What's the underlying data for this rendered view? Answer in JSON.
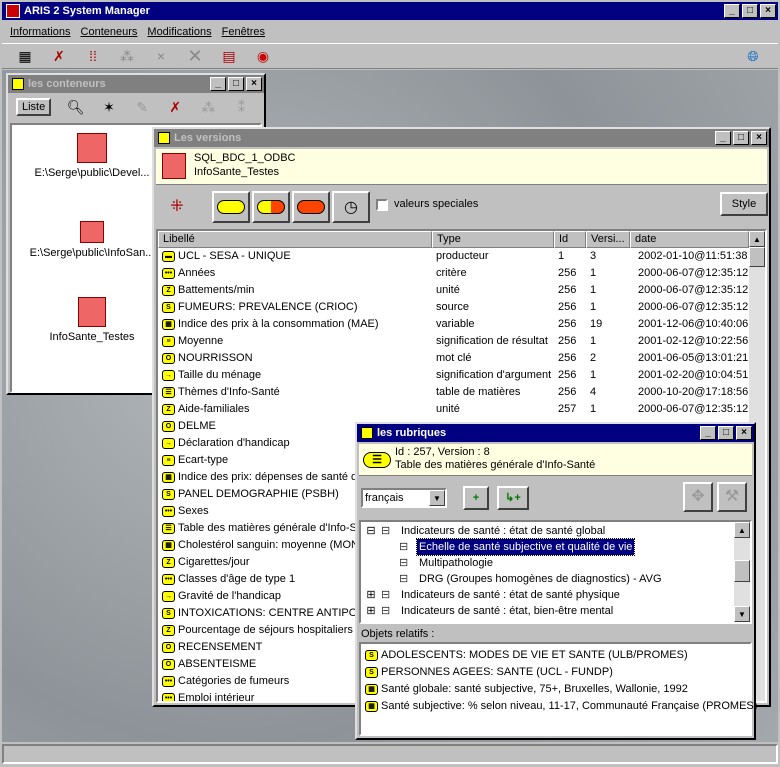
{
  "app": {
    "title": "ARIS 2 System Manager"
  },
  "menu": [
    "Informations",
    "Conteneurs",
    "Modifications",
    "Fenêtres"
  ],
  "conteneurs": {
    "title": "les conteneurs",
    "liste_label": "Liste",
    "items": [
      "E:\\Serge\\public\\Devel...",
      "E:\\Serge\\public\\InfoSan...",
      "InfoSante_Testes"
    ]
  },
  "versions": {
    "title": "Les versions",
    "db_line1": "SQL_BDC_1_ODBC",
    "db_line2": "InfoSante_Testes",
    "valeurs_label": "valeurs speciales",
    "style_label": "Style",
    "columns": [
      "Libellé",
      "Type",
      "Id",
      "Versi...",
      "date"
    ],
    "rows": [
      {
        "icon": "bar",
        "label": "UCL - SESA - UNIQUE",
        "type": "producteur",
        "id": "1",
        "ver": "3",
        "date": "2002-01-10@11:51:38"
      },
      {
        "icon": "dots",
        "label": "Années",
        "type": "critère",
        "id": "256",
        "ver": "1",
        "date": "2000-06-07@12:35:12"
      },
      {
        "icon": "z",
        "label": "Battements/min",
        "type": "unité",
        "id": "256",
        "ver": "1",
        "date": "2000-06-07@12:35:12"
      },
      {
        "icon": "src",
        "label": "FUMEURS: PREVALENCE (CRIOC)",
        "type": "source",
        "id": "256",
        "ver": "1",
        "date": "2000-06-07@12:35:12"
      },
      {
        "icon": "grid",
        "label": "Indice des prix à la consommation (MAE)",
        "type": "variable",
        "id": "256",
        "ver": "19",
        "date": "2001-12-06@10:40:06"
      },
      {
        "icon": "sig",
        "label": "Moyenne",
        "type": "signification de résultat",
        "id": "256",
        "ver": "1",
        "date": "2001-02-12@10:22:56"
      },
      {
        "icon": "key",
        "label": "NOURRISSON",
        "type": "mot clé",
        "id": "256",
        "ver": "2",
        "date": "2001-06-05@13:01:21"
      },
      {
        "icon": "arg",
        "label": "Taille du ménage",
        "type": "signification d'argument",
        "id": "256",
        "ver": "1",
        "date": "2001-02-20@10:04:51"
      },
      {
        "icon": "toc",
        "label": "Thèmes d'Info-Santé",
        "type": "table de matières",
        "id": "256",
        "ver": "4",
        "date": "2000-10-20@17:18:56"
      },
      {
        "icon": "z",
        "label": "Aide-familiales",
        "type": "unité",
        "id": "257",
        "ver": "1",
        "date": "2000-06-07@12:35:12"
      },
      {
        "icon": "key",
        "label": "DELME",
        "type": "",
        "id": "",
        "ver": "",
        "date": ""
      },
      {
        "icon": "arg",
        "label": "Déclaration d'handicap",
        "type": "",
        "id": "",
        "ver": "",
        "date": ""
      },
      {
        "icon": "sig",
        "label": "Ecart-type",
        "type": "",
        "id": "",
        "ver": "",
        "date": ""
      },
      {
        "icon": "grid",
        "label": "Indice des prix: dépenses de santé de",
        "type": "",
        "id": "",
        "ver": "",
        "date": ""
      },
      {
        "icon": "src",
        "label": "PANEL DEMOGRAPHIE (PSBH)",
        "type": "",
        "id": "",
        "ver": "",
        "date": ""
      },
      {
        "icon": "dots",
        "label": "Sexes",
        "type": "",
        "id": "",
        "ver": "",
        "date": ""
      },
      {
        "icon": "toc",
        "label": "Table des matières générale d'Info-Sa",
        "type": "",
        "id": "",
        "ver": "",
        "date": ""
      },
      {
        "icon": "grid",
        "label": "Cholestérol sanguin: moyenne (MONI",
        "type": "",
        "id": "",
        "ver": "",
        "date": ""
      },
      {
        "icon": "z",
        "label": "Cigarettes/jour",
        "type": "",
        "id": "",
        "ver": "",
        "date": ""
      },
      {
        "icon": "dots",
        "label": "Classes d'âge de type 1",
        "type": "",
        "id": "",
        "ver": "",
        "date": ""
      },
      {
        "icon": "arg",
        "label": "Gravité de l'handicap",
        "type": "",
        "id": "",
        "ver": "",
        "date": ""
      },
      {
        "icon": "src",
        "label": "INTOXICATIONS: CENTRE ANTIPO",
        "type": "",
        "id": "",
        "ver": "",
        "date": ""
      },
      {
        "icon": "z",
        "label": "Pourcentage de séjours hospitaliers",
        "type": "",
        "id": "",
        "ver": "",
        "date": ""
      },
      {
        "icon": "key",
        "label": "RECENSEMENT",
        "type": "",
        "id": "",
        "ver": "",
        "date": ""
      },
      {
        "icon": "key",
        "label": "ABSENTEISME",
        "type": "",
        "id": "",
        "ver": "",
        "date": ""
      },
      {
        "icon": "dots",
        "label": "Catégories de fumeurs",
        "type": "",
        "id": "",
        "ver": "",
        "date": ""
      },
      {
        "icon": "dots",
        "label": "Emploi intérieur",
        "type": "",
        "id": "",
        "ver": "",
        "date": ""
      }
    ]
  },
  "rubriques": {
    "title": "les rubriques",
    "info_line1": "Id : 257, Version : 8",
    "info_line2": "Table des matières générale d'Info-Santé",
    "language": "français",
    "tree": [
      {
        "indent": 0,
        "exp": "⊟",
        "label": "Indicateurs de santé : état de santé global",
        "sel": false
      },
      {
        "indent": 1,
        "exp": "",
        "label": "Echelle de santé subjective et qualité de vie",
        "sel": true
      },
      {
        "indent": 1,
        "exp": "",
        "label": "Multipathologie",
        "sel": false
      },
      {
        "indent": 1,
        "exp": "",
        "label": "DRG (Groupes homogènes de diagnostics) - AVG",
        "sel": false
      },
      {
        "indent": 0,
        "exp": "⊞",
        "label": "Indicateurs de santé : état de santé physique",
        "sel": false
      },
      {
        "indent": 0,
        "exp": "⊞",
        "label": "Indicateurs de santé : état,  bien-être mental",
        "sel": false
      }
    ],
    "objets_label": "Objets relatifs :",
    "objets": [
      {
        "icon": "src",
        "label": "ADOLESCENTS: MODES DE VIE ET SANTE (ULB/PROMES)"
      },
      {
        "icon": "src",
        "label": "PERSONNES AGEES: SANTE (UCL - FUNDP)"
      },
      {
        "icon": "grid",
        "label": "Santé globale: santé subjective, 75+, Bruxelles, Wallonie, 1992"
      },
      {
        "icon": "grid",
        "label": "Santé subjective: % selon niveau, 11-17, Communauté Française (PROMES)"
      }
    ]
  }
}
